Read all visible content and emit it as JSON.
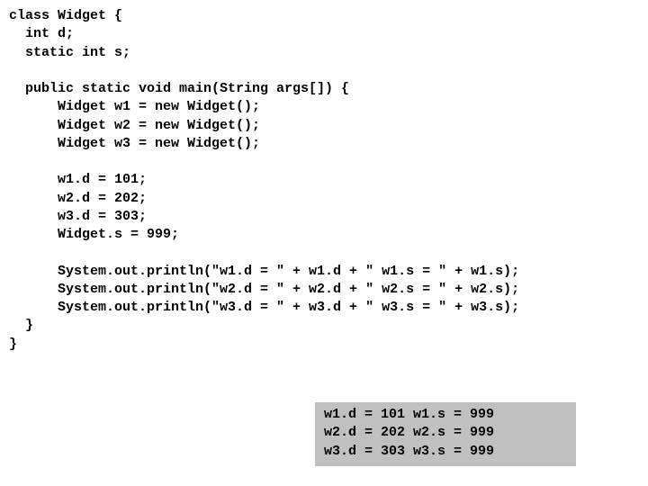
{
  "code": {
    "line01": "class Widget {",
    "line02": "  int d;",
    "line03": "  static int s;",
    "line04": "",
    "line05": "  public static void main(String args[]) {",
    "line06": "      Widget w1 = new Widget();",
    "line07": "      Widget w2 = new Widget();",
    "line08": "      Widget w3 = new Widget();",
    "line09": "",
    "line10": "      w1.d = 101;",
    "line11": "      w2.d = 202;",
    "line12": "      w3.d = 303;",
    "line13": "      Widget.s = 999;",
    "line14": "",
    "line15": "      System.out.println(\"w1.d = \" + w1.d + \" w1.s = \" + w1.s);",
    "line16": "      System.out.println(\"w2.d = \" + w2.d + \" w2.s = \" + w2.s);",
    "line17": "      System.out.println(\"w3.d = \" + w3.d + \" w3.s = \" + w3.s);",
    "line18": "  }",
    "line19": "}"
  },
  "output": {
    "line1": "w1.d = 101 w1.s = 999",
    "line2": "w2.d = 202 w2.s = 999",
    "line3": "w3.d = 303 w3.s = 999"
  }
}
